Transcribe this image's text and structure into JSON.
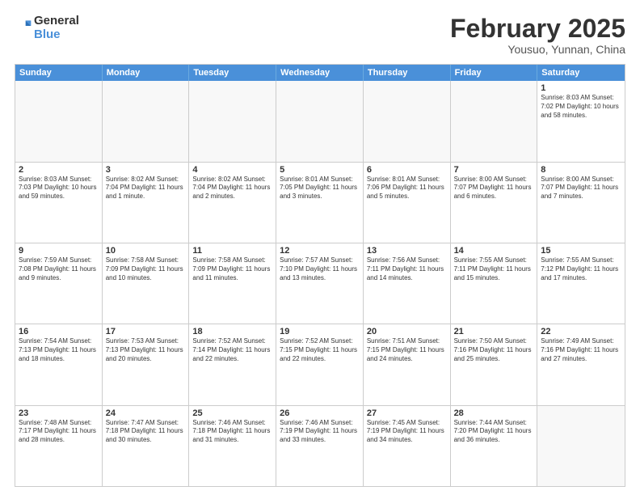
{
  "header": {
    "logo_general": "General",
    "logo_blue": "Blue",
    "month_title": "February 2025",
    "subtitle": "Yousuo, Yunnan, China"
  },
  "days_of_week": [
    "Sunday",
    "Monday",
    "Tuesday",
    "Wednesday",
    "Thursday",
    "Friday",
    "Saturday"
  ],
  "weeks": [
    [
      {
        "day": "",
        "info": ""
      },
      {
        "day": "",
        "info": ""
      },
      {
        "day": "",
        "info": ""
      },
      {
        "day": "",
        "info": ""
      },
      {
        "day": "",
        "info": ""
      },
      {
        "day": "",
        "info": ""
      },
      {
        "day": "1",
        "info": "Sunrise: 8:03 AM\nSunset: 7:02 PM\nDaylight: 10 hours and 58 minutes."
      }
    ],
    [
      {
        "day": "2",
        "info": "Sunrise: 8:03 AM\nSunset: 7:03 PM\nDaylight: 10 hours and 59 minutes."
      },
      {
        "day": "3",
        "info": "Sunrise: 8:02 AM\nSunset: 7:04 PM\nDaylight: 11 hours and 1 minute."
      },
      {
        "day": "4",
        "info": "Sunrise: 8:02 AM\nSunset: 7:04 PM\nDaylight: 11 hours and 2 minutes."
      },
      {
        "day": "5",
        "info": "Sunrise: 8:01 AM\nSunset: 7:05 PM\nDaylight: 11 hours and 3 minutes."
      },
      {
        "day": "6",
        "info": "Sunrise: 8:01 AM\nSunset: 7:06 PM\nDaylight: 11 hours and 5 minutes."
      },
      {
        "day": "7",
        "info": "Sunrise: 8:00 AM\nSunset: 7:07 PM\nDaylight: 11 hours and 6 minutes."
      },
      {
        "day": "8",
        "info": "Sunrise: 8:00 AM\nSunset: 7:07 PM\nDaylight: 11 hours and 7 minutes."
      }
    ],
    [
      {
        "day": "9",
        "info": "Sunrise: 7:59 AM\nSunset: 7:08 PM\nDaylight: 11 hours and 9 minutes."
      },
      {
        "day": "10",
        "info": "Sunrise: 7:58 AM\nSunset: 7:09 PM\nDaylight: 11 hours and 10 minutes."
      },
      {
        "day": "11",
        "info": "Sunrise: 7:58 AM\nSunset: 7:09 PM\nDaylight: 11 hours and 11 minutes."
      },
      {
        "day": "12",
        "info": "Sunrise: 7:57 AM\nSunset: 7:10 PM\nDaylight: 11 hours and 13 minutes."
      },
      {
        "day": "13",
        "info": "Sunrise: 7:56 AM\nSunset: 7:11 PM\nDaylight: 11 hours and 14 minutes."
      },
      {
        "day": "14",
        "info": "Sunrise: 7:55 AM\nSunset: 7:11 PM\nDaylight: 11 hours and 15 minutes."
      },
      {
        "day": "15",
        "info": "Sunrise: 7:55 AM\nSunset: 7:12 PM\nDaylight: 11 hours and 17 minutes."
      }
    ],
    [
      {
        "day": "16",
        "info": "Sunrise: 7:54 AM\nSunset: 7:13 PM\nDaylight: 11 hours and 18 minutes."
      },
      {
        "day": "17",
        "info": "Sunrise: 7:53 AM\nSunset: 7:13 PM\nDaylight: 11 hours and 20 minutes."
      },
      {
        "day": "18",
        "info": "Sunrise: 7:52 AM\nSunset: 7:14 PM\nDaylight: 11 hours and 22 minutes."
      },
      {
        "day": "19",
        "info": "Sunrise: 7:52 AM\nSunset: 7:15 PM\nDaylight: 11 hours and 22 minutes."
      },
      {
        "day": "20",
        "info": "Sunrise: 7:51 AM\nSunset: 7:15 PM\nDaylight: 11 hours and 24 minutes."
      },
      {
        "day": "21",
        "info": "Sunrise: 7:50 AM\nSunset: 7:16 PM\nDaylight: 11 hours and 25 minutes."
      },
      {
        "day": "22",
        "info": "Sunrise: 7:49 AM\nSunset: 7:16 PM\nDaylight: 11 hours and 27 minutes."
      }
    ],
    [
      {
        "day": "23",
        "info": "Sunrise: 7:48 AM\nSunset: 7:17 PM\nDaylight: 11 hours and 28 minutes."
      },
      {
        "day": "24",
        "info": "Sunrise: 7:47 AM\nSunset: 7:18 PM\nDaylight: 11 hours and 30 minutes."
      },
      {
        "day": "25",
        "info": "Sunrise: 7:46 AM\nSunset: 7:18 PM\nDaylight: 11 hours and 31 minutes."
      },
      {
        "day": "26",
        "info": "Sunrise: 7:46 AM\nSunset: 7:19 PM\nDaylight: 11 hours and 33 minutes."
      },
      {
        "day": "27",
        "info": "Sunrise: 7:45 AM\nSunset: 7:19 PM\nDaylight: 11 hours and 34 minutes."
      },
      {
        "day": "28",
        "info": "Sunrise: 7:44 AM\nSunset: 7:20 PM\nDaylight: 11 hours and 36 minutes."
      },
      {
        "day": "",
        "info": ""
      }
    ]
  ]
}
